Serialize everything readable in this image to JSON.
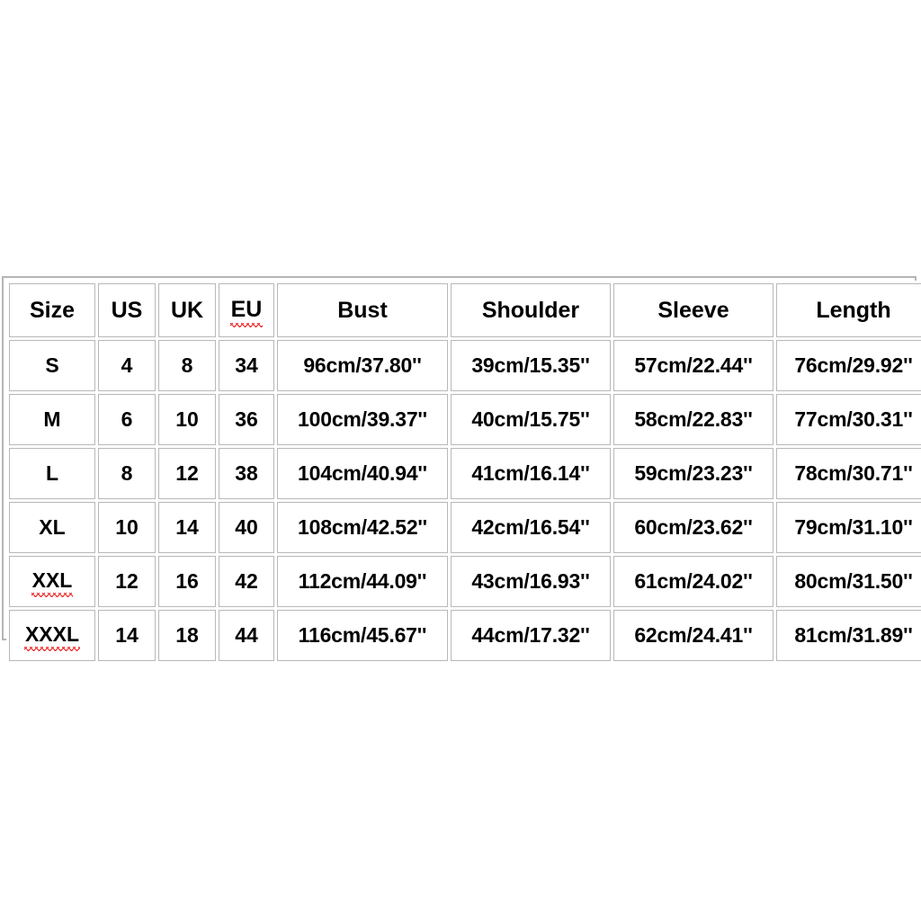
{
  "page": {
    "background_color": "#ffffff",
    "border_color": "#b8b8b8",
    "text_color": "#000000",
    "spellcheck_underline_color": "#ee2222"
  },
  "chart_data": {
    "type": "table",
    "title": "",
    "columns": [
      "Size",
      "US",
      "UK",
      "EU",
      "Bust",
      "Shoulder",
      "Sleeve",
      "Length"
    ],
    "misspelled_headers": [
      "EU"
    ],
    "misspelled_cells": [
      "XXL",
      "XXXL"
    ],
    "rows": [
      {
        "size": "S",
        "us": "4",
        "uk": "8",
        "eu": "34",
        "bust": "96cm/37.80''",
        "shoulder": "39cm/15.35''",
        "sleeve": "57cm/22.44''",
        "length": "76cm/29.92''"
      },
      {
        "size": "M",
        "us": "6",
        "uk": "10",
        "eu": "36",
        "bust": "100cm/39.37''",
        "shoulder": "40cm/15.75''",
        "sleeve": "58cm/22.83''",
        "length": "77cm/30.31''"
      },
      {
        "size": "L",
        "us": "8",
        "uk": "12",
        "eu": "38",
        "bust": "104cm/40.94''",
        "shoulder": "41cm/16.14''",
        "sleeve": "59cm/23.23''",
        "length": "78cm/30.71''"
      },
      {
        "size": "XL",
        "us": "10",
        "uk": "14",
        "eu": "40",
        "bust": "108cm/42.52''",
        "shoulder": "42cm/16.54''",
        "sleeve": "60cm/23.62''",
        "length": "79cm/31.10''"
      },
      {
        "size": "XXL",
        "us": "12",
        "uk": "16",
        "eu": "42",
        "bust": "112cm/44.09''",
        "shoulder": "43cm/16.93''",
        "sleeve": "61cm/24.02''",
        "length": "80cm/31.50''"
      },
      {
        "size": "XXXL",
        "us": "14",
        "uk": "18",
        "eu": "44",
        "bust": "116cm/45.67''",
        "shoulder": "44cm/17.32''",
        "sleeve": "62cm/24.41''",
        "length": "81cm/31.89''"
      }
    ]
  }
}
